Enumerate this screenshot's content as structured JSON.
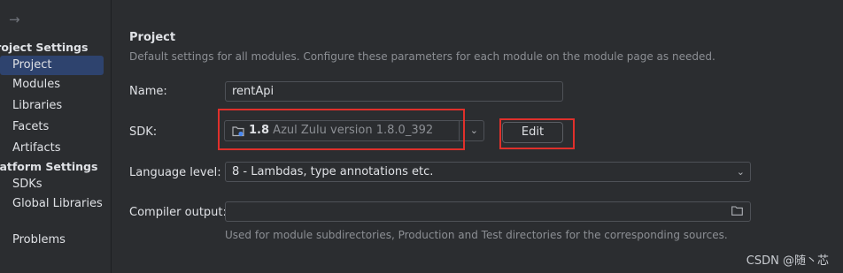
{
  "sidebar": {
    "back_icon": "arrow-right-icon",
    "sections": [
      {
        "label": "Project Settings"
      },
      {
        "label": "Platform Settings"
      }
    ],
    "items": [
      {
        "label": "Project",
        "selected": true
      },
      {
        "label": "Modules"
      },
      {
        "label": "Libraries"
      },
      {
        "label": "Facets"
      },
      {
        "label": "Artifacts"
      },
      {
        "label": "SDKs"
      },
      {
        "label": "Global Libraries"
      },
      {
        "label": "Problems"
      }
    ]
  },
  "main": {
    "title": "Project",
    "description": "Default settings for all modules. Configure these parameters for each module on the module page as needed.",
    "name": {
      "label": "Name:",
      "value": "rentApi"
    },
    "sdk": {
      "label": "SDK:",
      "version": "1.8",
      "detail": "Azul Zulu version 1.8.0_392",
      "edit_label": "Edit"
    },
    "language_level": {
      "label": "Language level:",
      "value": "8 - Lambdas, type annotations etc."
    },
    "compiler_output": {
      "label": "Compiler output:",
      "value": "",
      "hint": "Used for module subdirectories, Production and Test directories for the corresponding sources."
    }
  },
  "watermark": "CSDN @随丶芯",
  "colors": {
    "selection": "#2e436e",
    "highlight_box": "#e0302b",
    "background": "#2b2d30"
  }
}
